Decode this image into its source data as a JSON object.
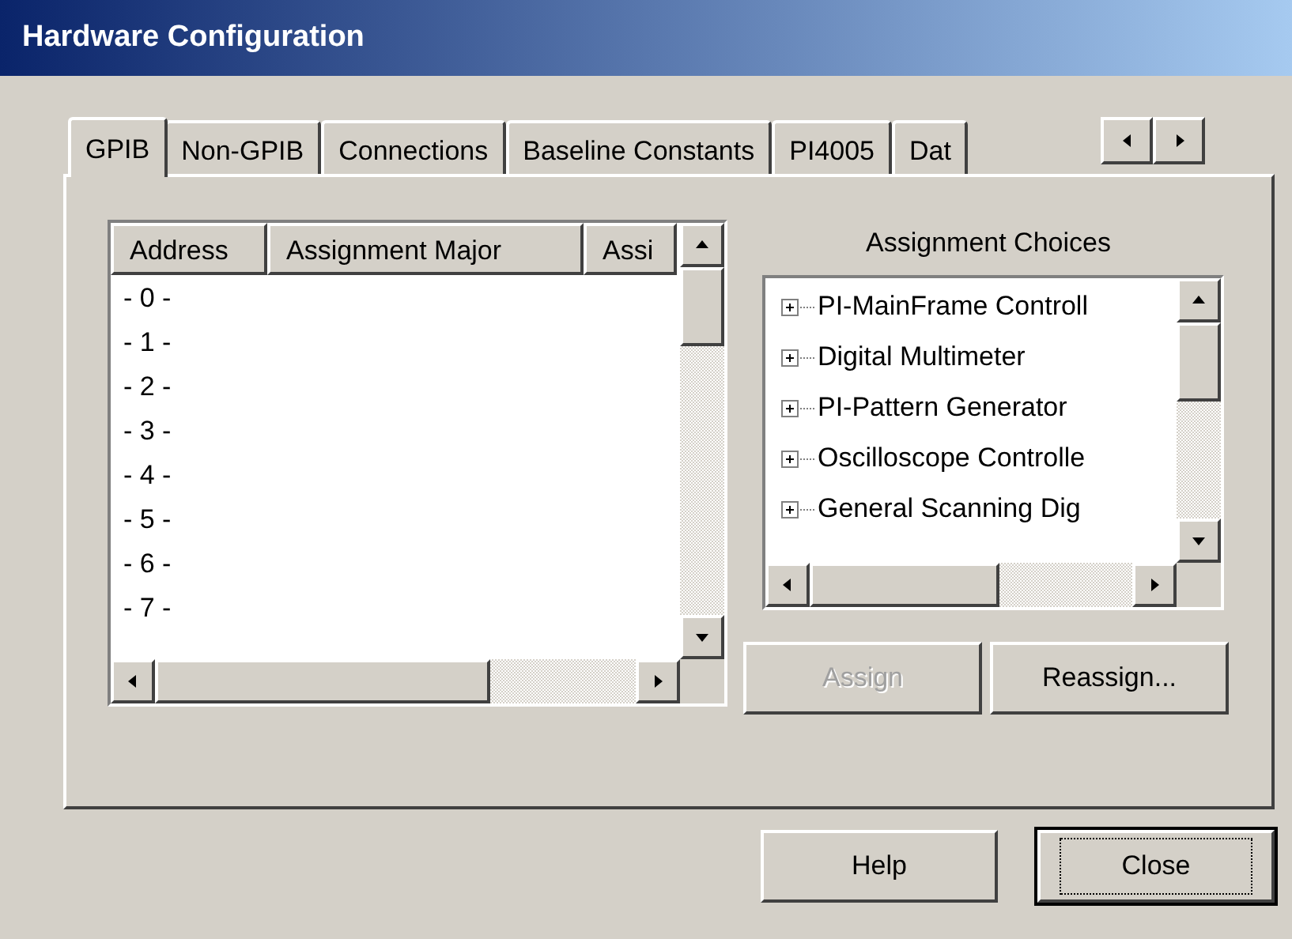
{
  "window": {
    "title": "Hardware Configuration"
  },
  "tabs": [
    {
      "label": "GPIB",
      "selected": true
    },
    {
      "label": "Non-GPIB",
      "selected": false
    },
    {
      "label": "Connections",
      "selected": false
    },
    {
      "label": "Baseline Constants",
      "selected": false
    },
    {
      "label": "PI4005",
      "selected": false
    },
    {
      "label": "Dat",
      "selected": false
    }
  ],
  "address_list": {
    "columns": [
      "Address",
      "Assignment Major",
      "Assi"
    ],
    "rows": [
      "- 0 -",
      "- 1 -",
      "- 2 -",
      "- 3 -",
      "- 4 -",
      "- 5 -",
      "- 6 -",
      "- 7 -"
    ]
  },
  "assignment_choices": {
    "label": "Assignment Choices",
    "items": [
      {
        "label": "PI-MainFrame Controll",
        "expanded": false
      },
      {
        "label": "Digital Multimeter",
        "expanded": false
      },
      {
        "label": "PI-Pattern Generator",
        "expanded": false
      },
      {
        "label": "Oscilloscope Controlle",
        "expanded": false
      },
      {
        "label": "General Scanning Dig",
        "expanded": false
      }
    ]
  },
  "buttons": [
    {
      "label": "Assign",
      "disabled": true
    },
    {
      "label": "Reassign...",
      "disabled": false
    }
  ],
  "footer_buttons": [
    {
      "label": "Help",
      "default": false
    },
    {
      "label": "Close",
      "default": true
    }
  ]
}
